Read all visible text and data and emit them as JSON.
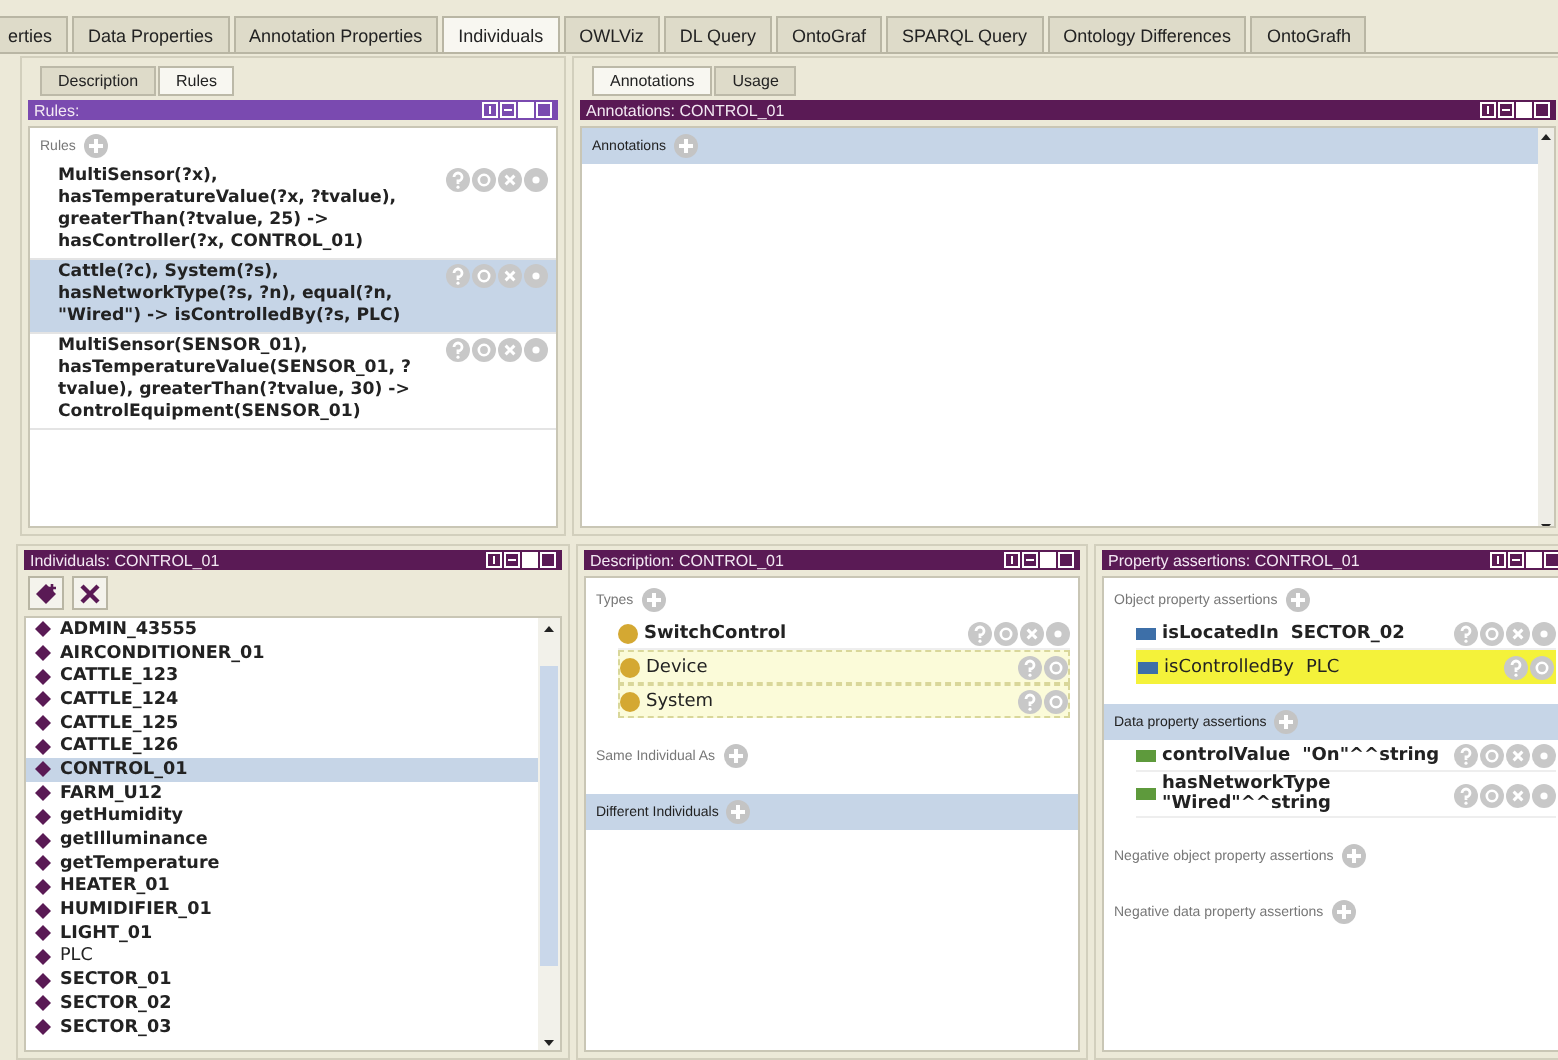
{
  "tabs": [
    {
      "label": "erties",
      "selected": false
    },
    {
      "label": "Data Properties",
      "selected": false
    },
    {
      "label": "Annotation Properties",
      "selected": false
    },
    {
      "label": "Individuals",
      "selected": true
    },
    {
      "label": "OWLViz",
      "selected": false
    },
    {
      "label": "DL Query",
      "selected": false
    },
    {
      "label": "OntoGraf",
      "selected": false
    },
    {
      "label": "SPARQL Query",
      "selected": false
    },
    {
      "label": "Ontology Differences",
      "selected": false
    },
    {
      "label": "OntoGrafh",
      "selected": false
    }
  ],
  "rules_panel": {
    "tabs": [
      {
        "label": "Description",
        "selected": false
      },
      {
        "label": "Rules",
        "selected": true
      }
    ],
    "title": "Rules:",
    "active": true,
    "section": "Rules",
    "rules": [
      {
        "text": "MultiSensor(?x), hasTemperatureValue(?x, ?tvalue), greaterThan(?tvalue, 25) -> hasController(?x, CONTROL_01)",
        "selected": false
      },
      {
        "text": "Cattle(?c), System(?s), hasNetworkType(?s, ?n), equal(?n, \"Wired\") -> isControlledBy(?s, PLC)",
        "selected": true
      },
      {
        "text": "MultiSensor(SENSOR_01), hasTemperatureValue(SENSOR_01, ?tvalue), greaterThan(?tvalue, 30) -> ControlEquipment(SENSOR_01)",
        "selected": false
      }
    ]
  },
  "annotations_panel": {
    "tabs": [
      {
        "label": "Annotations",
        "selected": true
      },
      {
        "label": "Usage",
        "selected": false
      }
    ],
    "title": "Annotations: CONTROL_01",
    "active": false,
    "section": "Annotations"
  },
  "individuals_panel": {
    "title": "Individuals: CONTROL_01",
    "active": false,
    "items": [
      {
        "label": "ADMIN_43555",
        "selected": false,
        "bold": true
      },
      {
        "label": "AIRCONDITIONER_01",
        "selected": false,
        "bold": true
      },
      {
        "label": "CATTLE_123",
        "selected": false,
        "bold": true
      },
      {
        "label": "CATTLE_124",
        "selected": false,
        "bold": true
      },
      {
        "label": "CATTLE_125",
        "selected": false,
        "bold": true
      },
      {
        "label": "CATTLE_126",
        "selected": false,
        "bold": true
      },
      {
        "label": "CONTROL_01",
        "selected": true,
        "bold": true
      },
      {
        "label": "FARM_U12",
        "selected": false,
        "bold": true
      },
      {
        "label": "getHumidity",
        "selected": false,
        "bold": true
      },
      {
        "label": "getIlluminance",
        "selected": false,
        "bold": true
      },
      {
        "label": "getTemperature",
        "selected": false,
        "bold": true
      },
      {
        "label": "HEATER_01",
        "selected": false,
        "bold": true
      },
      {
        "label": "HUMIDIFIER_01",
        "selected": false,
        "bold": true
      },
      {
        "label": "LIGHT_01",
        "selected": false,
        "bold": true
      },
      {
        "label": "PLC",
        "selected": false,
        "bold": false
      },
      {
        "label": "SECTOR_01",
        "selected": false,
        "bold": true
      },
      {
        "label": "SECTOR_02",
        "selected": false,
        "bold": true
      },
      {
        "label": "SECTOR_03",
        "selected": false,
        "bold": true
      }
    ]
  },
  "description_panel": {
    "title": "Description: CONTROL_01",
    "active": false,
    "sections": [
      {
        "label": "Types",
        "highlighted": false,
        "entries": [
          {
            "inferred": false,
            "kind": "class",
            "label": "SwitchControl"
          },
          {
            "inferred": true,
            "kind": "class",
            "label": "Device"
          },
          {
            "inferred": true,
            "kind": "class",
            "label": "System"
          }
        ]
      },
      {
        "label": "Same Individual As",
        "highlighted": false
      },
      {
        "label": "Different Individuals",
        "highlighted": true
      }
    ]
  },
  "property_panel": {
    "title": "Property assertions: CONTROL_01",
    "active": false,
    "sections": [
      {
        "label": "Object property assertions",
        "highlighted": false,
        "entries": [
          {
            "inferred": false,
            "kind": "object",
            "label": "isLocatedIn",
            "value": "SECTOR_02",
            "marked": false
          },
          {
            "inferred": true,
            "kind": "object",
            "label": "isControlledBy",
            "value": "PLC",
            "marked": true
          }
        ]
      },
      {
        "label": "Data property assertions",
        "highlighted": true,
        "entries": [
          {
            "inferred": false,
            "kind": "data",
            "label": "controlValue",
            "value": "\"On\"^^string",
            "marked": false
          },
          {
            "inferred": false,
            "kind": "data",
            "label": "hasNetworkType",
            "value": "\"Wired\"^^string",
            "marked": false
          }
        ]
      },
      {
        "label": "Negative object property assertions",
        "highlighted": false
      },
      {
        "label": "Negative data property assertions",
        "highlighted": false
      }
    ]
  }
}
